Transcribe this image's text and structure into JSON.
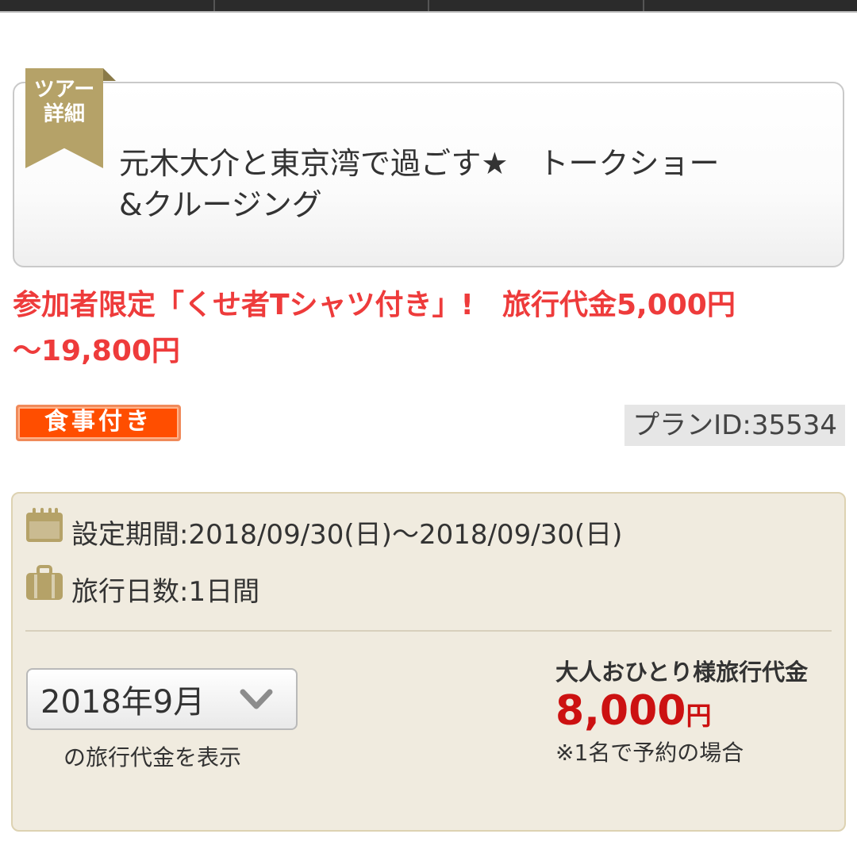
{
  "tour": {
    "ribbon_label_line1": "ツアー",
    "ribbon_label_line2": "詳細",
    "title_line1": "元木大介と東京湾で過ごす★　トークショー",
    "title_line2": "&クルージング"
  },
  "promo": {
    "line1": "参加者限定「くせ者Tシャツ付き」!　旅行代金5,000円",
    "line2": "〜19,800円"
  },
  "badges": {
    "meal": "食事付き",
    "plan_id": "プランID:35534"
  },
  "info": {
    "period": "設定期間:2018/09/30(日)〜2018/09/30(日)",
    "days": "旅行日数:1日間",
    "icons": [
      "calendar-icon",
      "suitcase-icon",
      "chevron-down-icon"
    ]
  },
  "month_select": {
    "selected": "2018年9月",
    "caption": "の旅行代金を表示"
  },
  "price": {
    "label": "大人おひとり様旅行代金",
    "amount": "8,000",
    "unit": "円",
    "note": "※1名で予約の場合"
  },
  "colors": {
    "promo_red": "#ee3b3b",
    "price_red": "#cc1111",
    "badge_orange": "#ff4e00",
    "ribbon_gold": "#b5a268",
    "info_bg": "#f0ebdf"
  }
}
